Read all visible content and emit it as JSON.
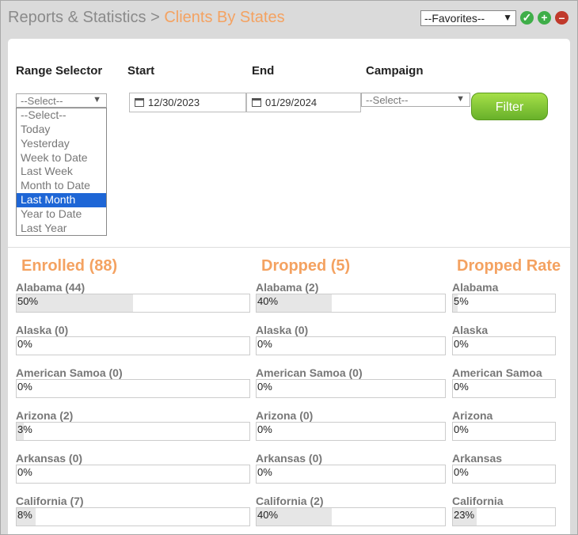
{
  "breadcrumb": {
    "parent": "Reports & Statistics",
    "sep": " > ",
    "current": "Clients By States"
  },
  "favorites": {
    "value": "--Favorites--",
    "add_icon": "check-icon",
    "plus_icon": "plus-icon",
    "remove_icon": "minus-icon"
  },
  "filters": {
    "range_label": "Range Selector",
    "range_value": "--Select--",
    "start_label": "Start",
    "start_value": "12/30/2023",
    "end_label": "End",
    "end_value": "01/29/2024",
    "campaign_label": "Campaign",
    "campaign_value": "--Select--",
    "filter_button": "Filter",
    "range_options": [
      "--Select--",
      "Today",
      "Yesterday",
      "Week to Date",
      "Last Week",
      "Month to Date",
      "Last Month",
      "Year to Date",
      "Last Year"
    ],
    "range_highlighted": "Last Month"
  },
  "columns": {
    "enrolled": "Enrolled (88)",
    "dropped": "Dropped (5)",
    "rate": "Dropped Rate"
  },
  "rows": [
    {
      "enrolled_label": "Alabama (44)",
      "enrolled_pct": "50%",
      "enrolled_value": 50,
      "dropped_label": "Alabama (2)",
      "dropped_pct": "40%",
      "dropped_value": 40,
      "rate_label": "Alabama",
      "rate_pct": "5%",
      "rate_value": 5
    },
    {
      "enrolled_label": "Alaska (0)",
      "enrolled_pct": "0%",
      "enrolled_value": 0,
      "dropped_label": "Alaska (0)",
      "dropped_pct": "0%",
      "dropped_value": 0,
      "rate_label": "Alaska",
      "rate_pct": "0%",
      "rate_value": 0
    },
    {
      "enrolled_label": "American Samoa (0)",
      "enrolled_pct": "0%",
      "enrolled_value": 0,
      "dropped_label": "American Samoa (0)",
      "dropped_pct": "0%",
      "dropped_value": 0,
      "rate_label": "American Samoa",
      "rate_pct": "0%",
      "rate_value": 0
    },
    {
      "enrolled_label": "Arizona (2)",
      "enrolled_pct": "3%",
      "enrolled_value": 3,
      "dropped_label": "Arizona (0)",
      "dropped_pct": "0%",
      "dropped_value": 0,
      "rate_label": "Arizona",
      "rate_pct": "0%",
      "rate_value": 0
    },
    {
      "enrolled_label": "Arkansas (0)",
      "enrolled_pct": "0%",
      "enrolled_value": 0,
      "dropped_label": "Arkansas (0)",
      "dropped_pct": "0%",
      "dropped_value": 0,
      "rate_label": "Arkansas",
      "rate_pct": "0%",
      "rate_value": 0
    },
    {
      "enrolled_label": "California (7)",
      "enrolled_pct": "8%",
      "enrolled_value": 8,
      "dropped_label": "California (2)",
      "dropped_pct": "40%",
      "dropped_value": 40,
      "rate_label": "California",
      "rate_pct": "23%",
      "rate_value": 23
    }
  ]
}
